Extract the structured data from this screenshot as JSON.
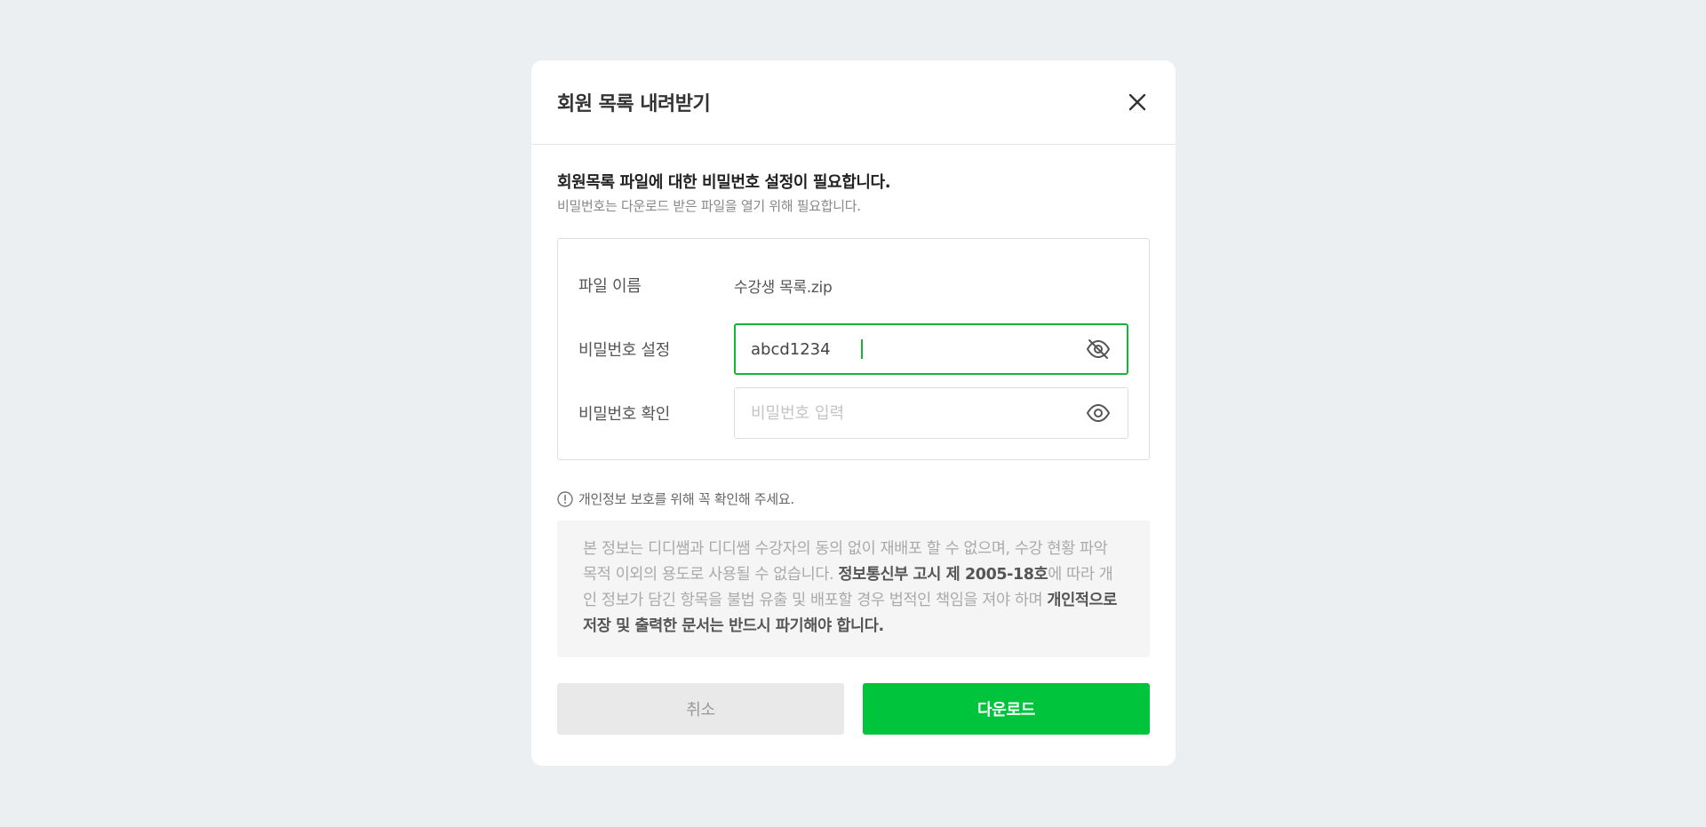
{
  "modal": {
    "title": "회원 목록 내려받기",
    "close_icon": "close-icon"
  },
  "description": {
    "main": "회원목록 파일에 대한 비밀번호 설정이 필요합니다.",
    "sub": "비밀번호는 다운로드 받은 파일을 열기 위해 필요합니다."
  },
  "form": {
    "file_label": "파일 이름",
    "file_name": "수강생 목록.zip",
    "password_label": "비밀번호 설정",
    "password_value": "abcd1234",
    "password_icon": "eye-off-icon",
    "confirm_label": "비밀번호 확인",
    "confirm_placeholder": "비밀번호 입력",
    "confirm_icon": "eye-icon"
  },
  "notice": {
    "headline": "개인정보 보호를 위해 꼭 확인해 주세요.",
    "text_1": "본 정보는 디디쌤과 디디쌤 수강자의 동의 없이 재배포 할 수 없으며, 수강 현황 파악 목적 이외의 용도로 사용될 수 없습니다. ",
    "bold_1": "정보통신부 고시 제 2005-18호",
    "text_2": "에 따라 개인 정보가 담긴 항목을 불법 유출 및 배포할 경우 법적인 책임을 져야 하며 ",
    "bold_2": "개인적으로 저장 및 출력한 문서는 반드시 파기해야 합니다."
  },
  "buttons": {
    "cancel": "취소",
    "download": "다운로드"
  },
  "colors": {
    "accent": "#00c43c",
    "background": "#ebeff2"
  }
}
